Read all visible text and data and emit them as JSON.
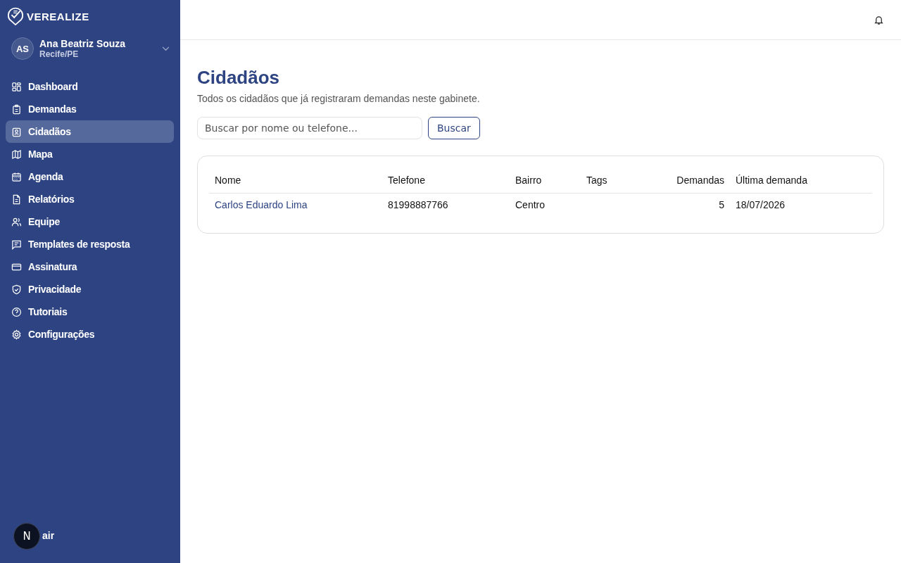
{
  "sidebar": {
    "brand": "VEREALIZE",
    "user": {
      "initials": "AS",
      "name": "Ana Beatriz Souza",
      "location": "Recife/PE"
    },
    "items": [
      {
        "label": "Dashboard",
        "selected": false
      },
      {
        "label": "Demandas",
        "selected": false
      },
      {
        "label": "Cidadãos",
        "selected": true
      },
      {
        "label": "Mapa",
        "selected": false
      },
      {
        "label": "Agenda",
        "selected": false
      },
      {
        "label": "Relatórios",
        "selected": false
      },
      {
        "label": "Equipe",
        "selected": false
      },
      {
        "label": "Templates de resposta",
        "selected": false
      },
      {
        "label": "Assinatura",
        "selected": false
      },
      {
        "label": "Privacidade",
        "selected": false
      },
      {
        "label": "Tutoriais",
        "selected": false
      },
      {
        "label": "Configurações",
        "selected": false
      }
    ],
    "logout": "air",
    "dev_badge": "N"
  },
  "page": {
    "title": "Cidadãos",
    "subtitle": "Todos os cidadãos que já registraram demandas neste gabinete.",
    "search": {
      "placeholder": "Buscar por nome ou telefone..."
    },
    "search_button": "Buscar"
  },
  "table": {
    "columns": [
      "Nome",
      "Telefone",
      "Bairro",
      "Tags",
      "Demandas",
      "Última demanda"
    ],
    "rows": [
      [
        "Carlos Eduardo Lima",
        "81998887766",
        "Centro",
        "",
        "5",
        "18/07/2026"
      ]
    ]
  }
}
